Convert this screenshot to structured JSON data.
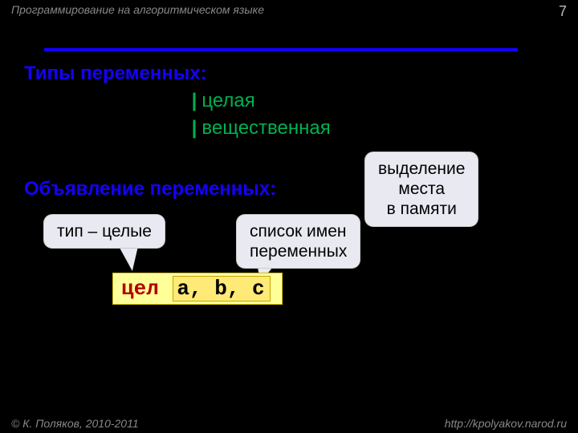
{
  "header": {
    "title": "Программирование на алгоритмическом языке",
    "page": "7"
  },
  "section_types": {
    "heading": "Типы переменных:",
    "items": [
      {
        "key": "",
        "label": "целая"
      },
      {
        "key": "",
        "label": "вещественная"
      }
    ]
  },
  "section_decl": {
    "heading": "Объявление переменных:"
  },
  "callouts": {
    "type": "тип – целые",
    "list": "список имен переменных",
    "memory": "выделение места в памяти"
  },
  "code": {
    "keyword": "цел",
    "vars": "a, b, c"
  },
  "footer": {
    "copyright": "© К. Поляков, 2010-2011",
    "url": "http://kpolyakov.narod.ru"
  }
}
